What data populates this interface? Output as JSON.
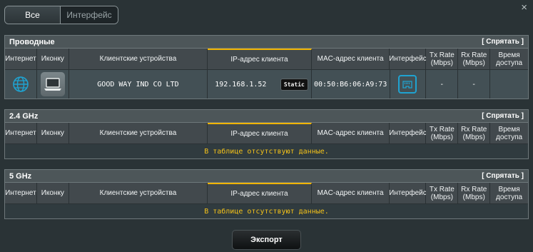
{
  "toggle": {
    "all": "Все",
    "interface": "Интерфейс"
  },
  "close": "×",
  "columns": {
    "internet": "Интернет",
    "icon": "Иконку",
    "clients": "Клиентские устройства",
    "ip": "IP-адрес клиента",
    "mac": "MAC-адрес клиента",
    "interface": "Интерфейс",
    "tx": "Tx Rate (Mbps)",
    "rx": "Rx Rate (Mbps)",
    "time": "Время доступа"
  },
  "sections": {
    "wired": {
      "title": "Проводные",
      "hide": "[ Спрятать ]",
      "rows": [
        {
          "internet_icon": "globe-icon",
          "device_icon": "laptop-icon",
          "name": "GOOD WAY IND CO LTD",
          "ip": "192.168.1.52",
          "ip_type": "Static",
          "mac": "00:50:B6:06:A9:73",
          "interface_icon": "ethernet-port-icon",
          "tx": "-",
          "rx": "-",
          "time": ""
        }
      ]
    },
    "ghz24": {
      "title": "2.4 GHz",
      "hide": "[ Спрятать ]",
      "empty": "В таблице отсутствуют данные."
    },
    "ghz5": {
      "title": "5 GHz",
      "hide": "[ Спрятать ]",
      "empty": "В таблице отсутствуют данные."
    }
  },
  "export": "Экспорт",
  "colors": {
    "accent": "#f0b400",
    "interface_icon": "#1fa3d1",
    "empty_text": "#f4c21a"
  }
}
